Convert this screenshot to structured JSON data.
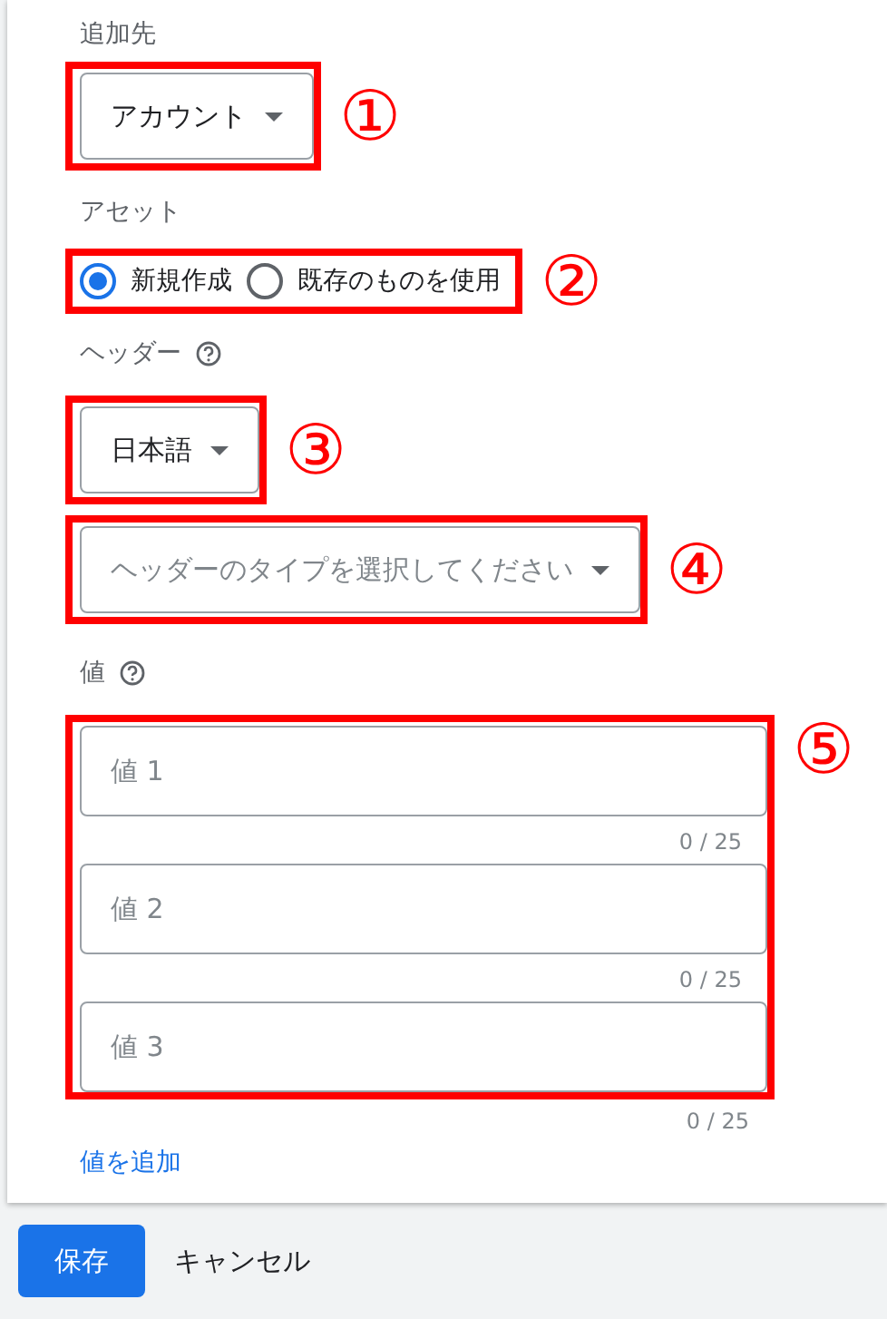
{
  "destination": {
    "label": "追加先",
    "value": "アカウント",
    "callout": "①"
  },
  "asset": {
    "label": "アセット",
    "callout": "②",
    "options": [
      {
        "label": "新規作成",
        "selected": true
      },
      {
        "label": "既存のものを使用",
        "selected": false
      }
    ]
  },
  "header": {
    "label": "ヘッダー",
    "language": {
      "value": "日本語",
      "callout": "③"
    },
    "type": {
      "placeholder": "ヘッダーのタイプを選択してください",
      "callout": "④"
    }
  },
  "values": {
    "label": "値",
    "callout": "⑤",
    "fields": [
      {
        "placeholder": "値 1",
        "counter": "0 / 25"
      },
      {
        "placeholder": "値 2",
        "counter": "0 / 25"
      },
      {
        "placeholder": "値 3",
        "counter": "0 / 25"
      }
    ],
    "add_link": "値を追加"
  },
  "buttons": {
    "save": "保存",
    "cancel": "キャンセル"
  }
}
